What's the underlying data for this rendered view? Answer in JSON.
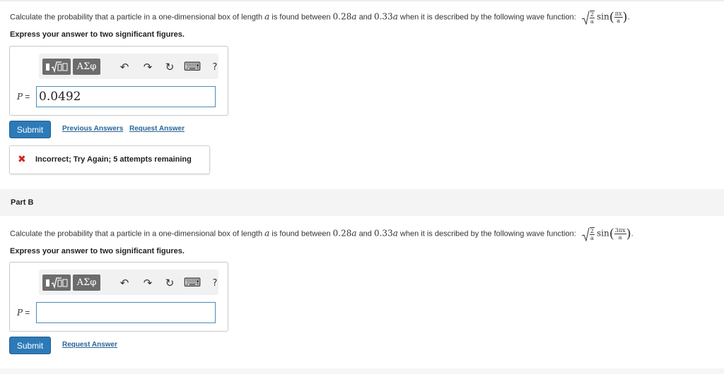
{
  "partA": {
    "question_prefix": "Calculate the probability that a particle in a one-dimensional box of length",
    "var_a": "a",
    "mid1": "is found between",
    "lower": "0.28",
    "mid2": "and",
    "upper": "0.33",
    "mid3": "when it is described by the following wave function:",
    "sqrt_num": "2",
    "sqrt_den": "a",
    "fn": "sin",
    "arg_num": "πx",
    "arg_den": "a",
    "express": "Express your answer to two significant figures.",
    "p_label": "P",
    "equals": "=",
    "answer_value": "0.0492",
    "submit": "Submit",
    "previous_answers": "Previous Answers",
    "request_answer": "Request Answer",
    "feedback_icon": "✖",
    "feedback_text": "Incorrect; Try Again; 5 attempts remaining"
  },
  "partB": {
    "header": "Part B",
    "question_prefix": "Calculate the probability that a particle in a one-dimensional box of length",
    "var_a": "a",
    "mid1": "is found between",
    "lower": "0.28",
    "mid2": "and",
    "upper": "0.33",
    "mid3": "when it is described by the following wave function:",
    "sqrt_num": "2",
    "sqrt_den": "a",
    "fn": "sin",
    "arg_num": "3πx",
    "arg_den": "a",
    "express": "Express your answer to two significant figures.",
    "p_label": "P",
    "equals": "=",
    "answer_value": "",
    "submit": "Submit",
    "request_answer": "Request Answer"
  },
  "toolbar": {
    "symbols_label": "ΑΣφ",
    "undo_icon": "↶",
    "redo_icon": "↷",
    "reset_icon": "↻",
    "keyboard_icon": "⌨",
    "help_label": "?"
  },
  "icons": [
    "templates-icon",
    "undo-icon",
    "redo-icon",
    "reset-icon",
    "keyboard-icon",
    "help-icon",
    "incorrect-icon"
  ],
  "colors": {
    "submit": "#2d7ab8",
    "link": "#2a6496",
    "incorrect": "#d0281e",
    "input_border": "#4a8db8"
  }
}
